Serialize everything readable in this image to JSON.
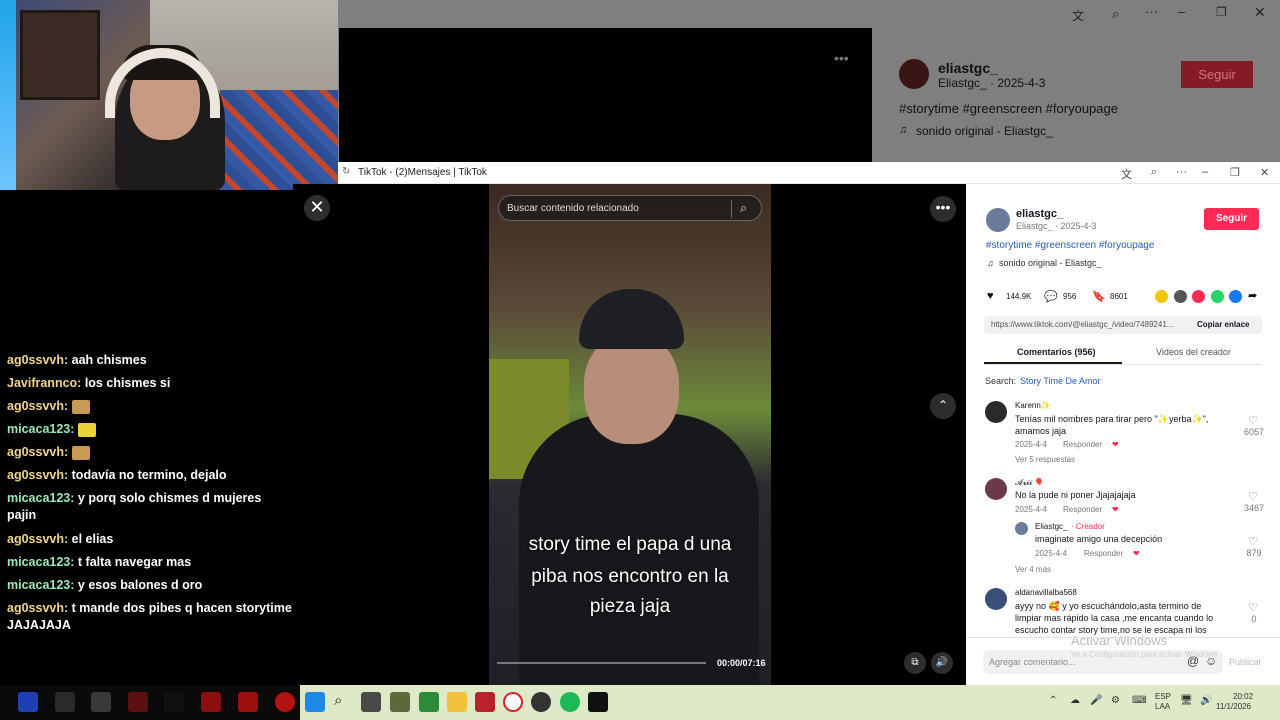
{
  "bg_window": {
    "username": "eliastgc_",
    "subtitle": "Eliastgc_ · 2025-4-3",
    "follow": "Seguir",
    "hashtags": "#storytime #greenscreen #foryoupage",
    "sound": "sonido original - Eliastgc_"
  },
  "chat": [
    {
      "user": "ag0ssvvh:",
      "text": "aah chismes",
      "color": "#f0d58a"
    },
    {
      "user": "Javifrannco:",
      "text": "los chismes si",
      "color": "#f0d58a"
    },
    {
      "user": "ag0ssvvh:",
      "text": "",
      "color": "#f0d58a",
      "emote": "#c99a52"
    },
    {
      "user": "micaca123:",
      "text": "",
      "color": "#9be7b8",
      "emote": "#e9d23a"
    },
    {
      "user": "ag0ssvvh:",
      "text": "",
      "color": "#f0d58a",
      "emote": "#c99a52"
    },
    {
      "user": "ag0ssvvh:",
      "text": "todavía no termino, dejalo",
      "color": "#f0d58a"
    },
    {
      "user": "micaca123:",
      "text": "y porq solo chismes d mujeres pajin",
      "color": "#9be7b8"
    },
    {
      "user": "ag0ssvvh:",
      "text": "el elias",
      "color": "#f0d58a"
    },
    {
      "user": "micaca123:",
      "text": "t falta navegar mas",
      "color": "#9be7b8"
    },
    {
      "user": "micaca123:",
      "text": "y esos balones d oro",
      "color": "#9be7b8"
    },
    {
      "user": "ag0ssvvh:",
      "text": "t mande dos pibes q hacen storytime JAJAJAJA",
      "color": "#f0d58a"
    }
  ],
  "popup": {
    "title": "TikTok - (2)Mensajes | TikTok",
    "search_placeholder": "Buscar contenido relacionado",
    "caption_lines": [
      "story time el papa d una",
      "piba nos encontro en la",
      "pieza jaja"
    ],
    "time": "00:00/07:16",
    "progress": 0.0
  },
  "panel": {
    "username": "eliastgc_",
    "subtitle": "Eliastgc_ · 2025-4-3",
    "follow": "Seguir",
    "hashtags": "#storytime #greenscreen #foryoupage",
    "sound": "sonido original - Eliastgc_",
    "likes": "144.9K",
    "comments": "956",
    "saves": "8601",
    "link": "https://www.tiktok.com/@eliastgc_/video/7489241...",
    "copy_link": "Copiar enlace",
    "tab_comments": "Comentarios (956)",
    "tab_creator": "Videos del creador",
    "search_label": "Search:",
    "search_value": "Story Time De Amor",
    "comments_list": [
      {
        "name": "Karenn✨",
        "text": "Tenías mil nombres para tirar pero \"✨yerba✨\", amamos jaja",
        "date": "2025-4-4",
        "reply": "Responder",
        "likes": "6057",
        "more": "Ver 5 respuestas"
      },
      {
        "name": "𝓐𝓻𝓲𝓲 🎈",
        "text": "No la pude ni poner Jjajajajaja",
        "date": "2025-4-4",
        "reply": "Responder",
        "likes": "3467"
      },
      {
        "name": "Eliastgc_",
        "creator": "· Creador",
        "text": "imaginate amigo una decepción",
        "date": "2025-4-4",
        "reply": "Responder",
        "likes": "879",
        "more": "Ver 4 más"
      },
      {
        "name": "aldanavillalba568",
        "text": "ayyy no 🥰 y yo escuchándolo,asta termino de limpiar mas rápido la casa ,me encanta cuando lo escucho contar story time,no se le escapa ni los",
        "likes": "0"
      }
    ],
    "comment_placeholder": "Agregar comentario...",
    "publish": "Publicar",
    "watermark_title": "Activar Windows",
    "watermark_sub": "Ve a Configuración para activar Windows."
  },
  "taskbar": {
    "lang": "ESP",
    "lang2": "LAA",
    "time": "20:02",
    "date": "11/1/2026"
  }
}
